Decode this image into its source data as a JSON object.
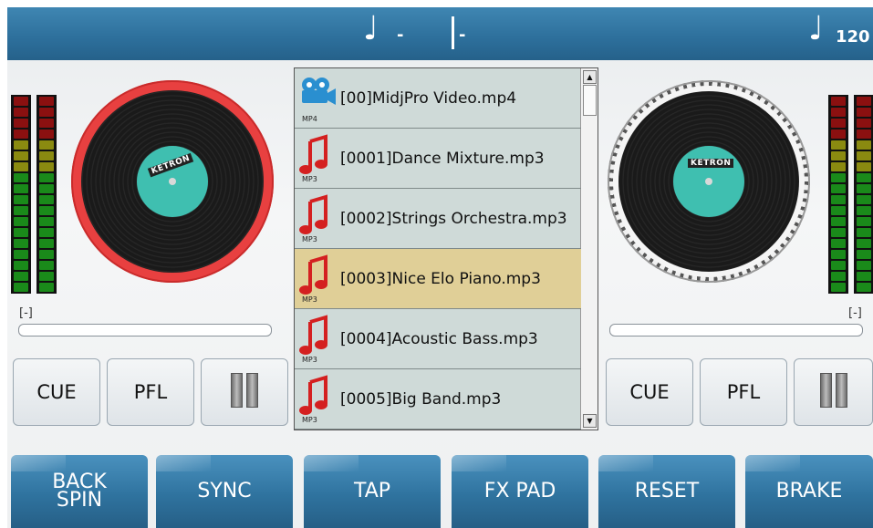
{
  "topbar": {
    "left_value": "-",
    "middle_value": "-",
    "tempo": "120"
  },
  "left_deck": {
    "brand": "KETRON",
    "ring_color": "#e84040",
    "bracket_label": "[-]",
    "buttons": {
      "cue": "CUE",
      "pfl": "PFL"
    }
  },
  "right_deck": {
    "brand": "KETRON",
    "ring_color": "#e8e8e8",
    "bracket_label": "[-]",
    "buttons": {
      "cue": "CUE",
      "pfl": "PFL"
    }
  },
  "file_list": {
    "items": [
      {
        "name": "[00]MidjPro Video.mp4",
        "type": "MP4",
        "icon": "video-icon"
      },
      {
        "name": "[0001]Dance Mixture.mp3",
        "type": "MP3",
        "icon": "music-note-icon"
      },
      {
        "name": "[0002]Strings Orchestra.mp3",
        "type": "MP3",
        "icon": "music-note-icon"
      },
      {
        "name": "[0003]Nice Elo Piano.mp3",
        "type": "MP3",
        "icon": "music-note-icon"
      },
      {
        "name": "[0004]Acoustic Bass.mp3",
        "type": "MP3",
        "icon": "music-note-icon"
      },
      {
        "name": "[0005]Big Band.mp3",
        "type": "MP3",
        "icon": "music-note-icon"
      }
    ],
    "selected_index": 3
  },
  "bottom_bar": {
    "back_spin": "BACK SPIN",
    "sync": "SYNC",
    "tap": "TAP",
    "fx_pad": "FX PAD",
    "reset": "RESET",
    "brake": "BRAKE"
  },
  "colors": {
    "accent_blue": "#2d6f9b",
    "selected_row": "#e0cf97",
    "turntable_label": "#3fbfb0"
  }
}
